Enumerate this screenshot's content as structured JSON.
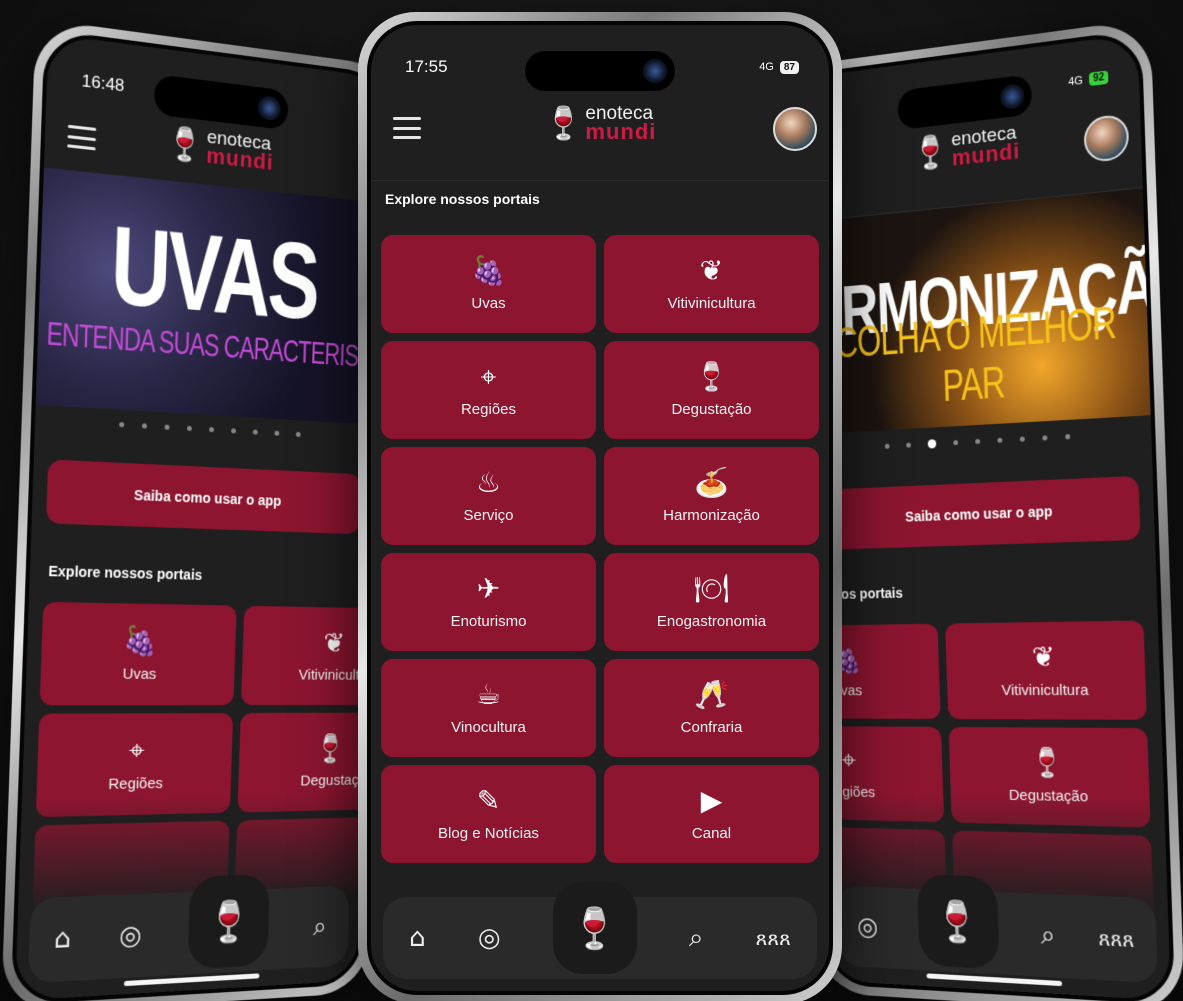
{
  "center": {
    "status": {
      "time": "17:55",
      "signal": "4G",
      "battery": "87"
    },
    "section_title": "Explore nossos portais",
    "portals": [
      {
        "label": "Uvas",
        "icon": "grapes-icon",
        "glyph": "🍇"
      },
      {
        "label": "Vitivinicultura",
        "icon": "vine-icon",
        "glyph": "❦"
      },
      {
        "label": "Regiões",
        "icon": "map-pin-icon",
        "glyph": "⌖"
      },
      {
        "label": "Degustação",
        "icon": "wine-glass-icon",
        "glyph": "🍷"
      },
      {
        "label": "Serviço",
        "icon": "wine-bucket-icon",
        "glyph": "♨"
      },
      {
        "label": "Harmonização",
        "icon": "pasta-plate-icon",
        "glyph": "🍝"
      },
      {
        "label": "Enoturismo",
        "icon": "globe-plane-icon",
        "glyph": "✈"
      },
      {
        "label": "Enogastronomia",
        "icon": "cloche-icon",
        "glyph": "🍽"
      },
      {
        "label": "Vinocultura",
        "icon": "sommelier-icon",
        "glyph": "☕"
      },
      {
        "label": "Confraria",
        "icon": "toast-glasses-icon",
        "glyph": "🥂"
      },
      {
        "label": "Blog e Notícias",
        "icon": "blog-icon",
        "glyph": "✎"
      },
      {
        "label": "Canal",
        "icon": "video-channel-icon",
        "glyph": "▶"
      }
    ]
  },
  "left": {
    "status": {
      "time": "16:48"
    },
    "banner_title": "UVAS",
    "banner_subtitle": "ENTENDA SUAS CARACTERIST",
    "cta": "Saiba como usar o app",
    "section_title": "Explore nossos portais",
    "portals": [
      {
        "label": "Uvas",
        "glyph": "🍇"
      },
      {
        "label": "Vitivinicultu",
        "glyph": "❦"
      },
      {
        "label": "Regiões",
        "glyph": "⌖"
      },
      {
        "label": "Degustaç",
        "glyph": "🍷"
      }
    ]
  },
  "right": {
    "status": {
      "signal": "4G",
      "battery": "92"
    },
    "banner_title": "ARMONIZAÇÃO",
    "banner_subtitle": "COLHA O MELHOR PAR",
    "cta": "Saiba como usar o app",
    "section_title": "ossos portais",
    "portals": [
      {
        "label": "Uvas",
        "glyph": "🍇"
      },
      {
        "label": "Vitivinicultura",
        "glyph": "❦"
      },
      {
        "label": "Regiões",
        "glyph": "⌖"
      },
      {
        "label": "Degustação",
        "glyph": "🍷"
      }
    ]
  },
  "logo": {
    "line1": "enoteca",
    "line2": "mundi"
  },
  "nav": {
    "home": "⌂",
    "location": "◎",
    "wine": "🍷",
    "search": "⌕",
    "community": "ጸጸጸ"
  },
  "colors": {
    "accent": "#8d1530",
    "brand": "#d11a43",
    "background": "#1f1f1f"
  }
}
